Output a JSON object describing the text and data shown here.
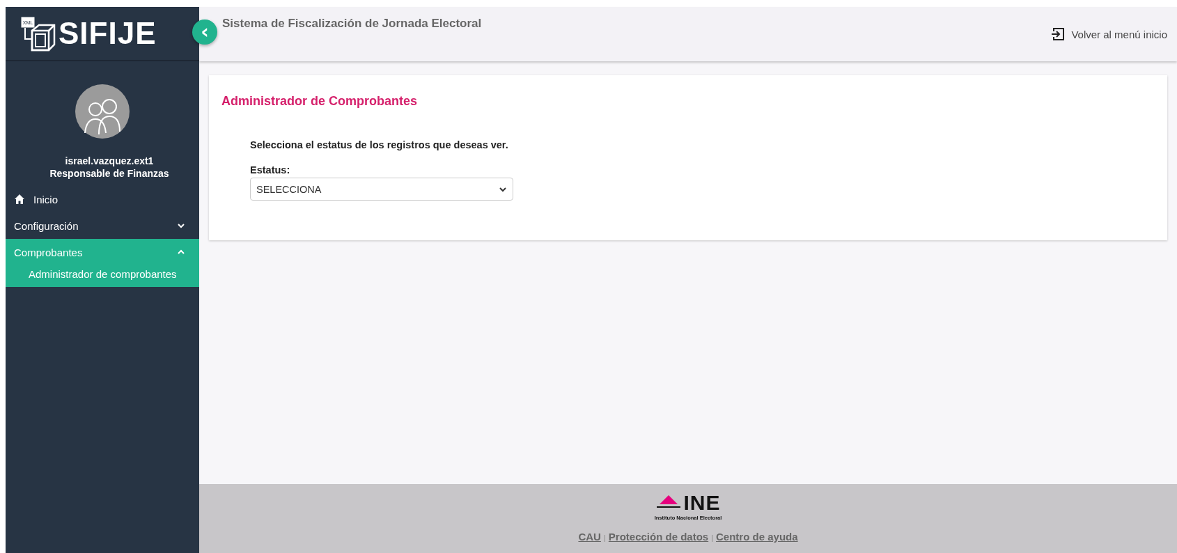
{
  "sidebar": {
    "logo": {
      "badge": "XML",
      "name": "SIFIJE"
    },
    "collapse_button": {
      "label": "‹"
    },
    "user": {
      "username": "israel.vazquez.ext1",
      "role": "Responsable de Finanzas"
    },
    "items": [
      {
        "label": "Inicio",
        "kind": "home",
        "selected": false
      },
      {
        "label": "Configuración",
        "kind": "group",
        "expanded": false,
        "selected": false
      },
      {
        "label": "Comprobantes",
        "kind": "group",
        "expanded": true,
        "selected": true,
        "children": [
          {
            "label": "Administrador de comprobantes",
            "selected": false
          }
        ]
      }
    ]
  },
  "header": {
    "title": "Sistema de Fiscalización de Jornada Electoral",
    "back_link": "Volver al menú inicio"
  },
  "card": {
    "title": "Administrador de Comprobantes",
    "instruction": "Selecciona el estatus de los registros que deseas ver.",
    "field_label": "Estatus:",
    "select_value": "SELECCIONA"
  },
  "footer": {
    "logo": {
      "name": "INE",
      "subtitle": "Instituto Nacional Electoral"
    },
    "links": [
      "CAU",
      "Protección de datos",
      "Centro de ayuda"
    ],
    "separator": "|"
  }
}
